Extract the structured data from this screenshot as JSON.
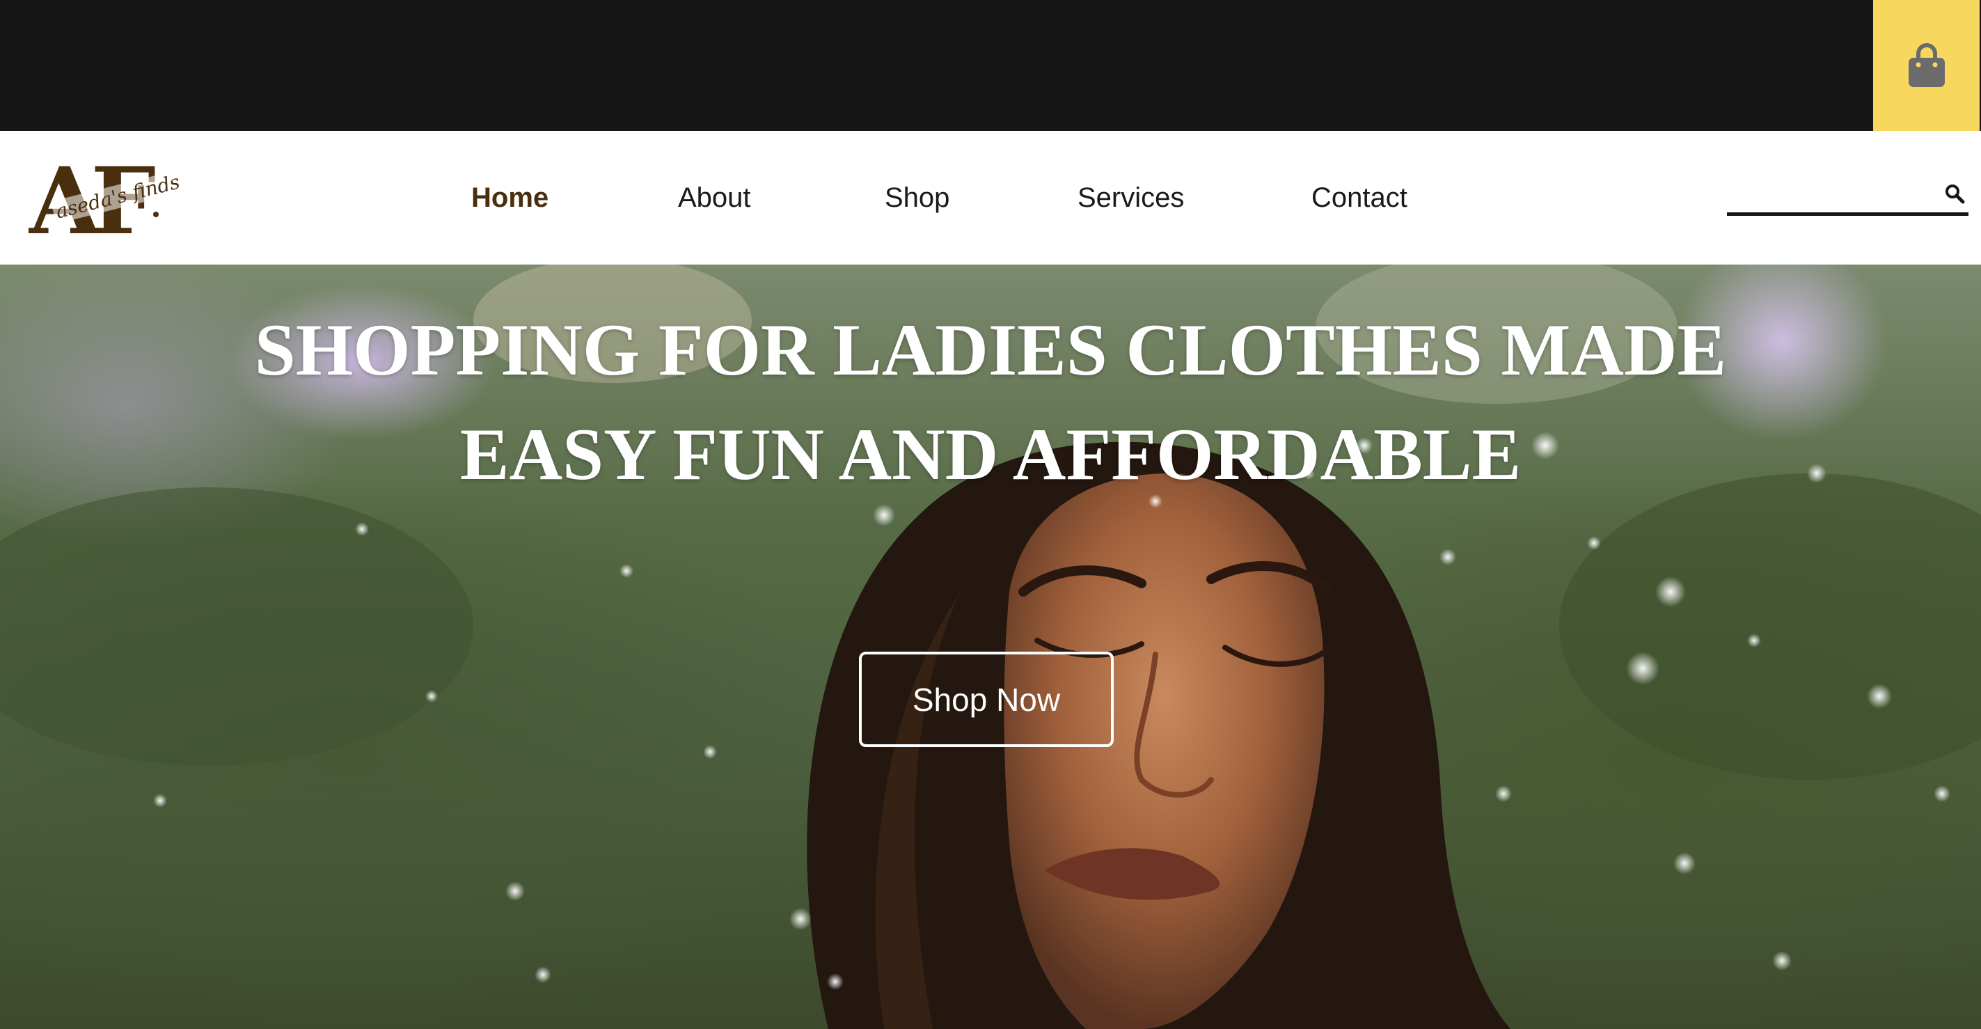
{
  "top_bar": {
    "cart_icon": "shopping-bag-icon",
    "accent_color": "#f8d75f",
    "background_color": "#161616"
  },
  "header": {
    "logo": {
      "mark": "AF",
      "script": "aseda's finds"
    },
    "nav": [
      {
        "label": "Home",
        "active": true
      },
      {
        "label": "About",
        "active": false
      },
      {
        "label": "Shop",
        "active": false
      },
      {
        "label": "Services",
        "active": false
      },
      {
        "label": "Contact",
        "active": false
      }
    ],
    "active_color": "#4a2f0f",
    "search": {
      "value": "",
      "icon": "search-icon"
    }
  },
  "hero": {
    "title_line_1": "SHOPPING FOR LADIES CLOTHES MADE",
    "title_line_2": "EASY FUN AND AFFORDABLE",
    "cta_label": "Shop Now"
  }
}
